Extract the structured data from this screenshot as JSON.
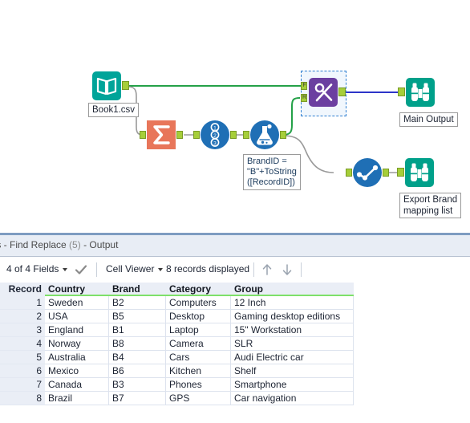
{
  "app": "Alteryx Designer",
  "canvas": {
    "nodes": [
      {
        "id": "input",
        "name": "Input Data",
        "icon": "book-icon",
        "label": "Book1.csv"
      },
      {
        "id": "summarize",
        "name": "Summarize",
        "icon": "sigma-icon",
        "label": ""
      },
      {
        "id": "recordid",
        "name": "Record ID",
        "icon": "numbers-icon",
        "label": ""
      },
      {
        "id": "formula",
        "name": "Formula",
        "icon": "flask-icon",
        "label": ""
      },
      {
        "id": "findreplace",
        "name": "Find Replace",
        "icon": "scissors-icon",
        "label": "",
        "selected": true
      },
      {
        "id": "select",
        "name": "Select",
        "icon": "checkline-icon",
        "label": ""
      },
      {
        "id": "browse1",
        "name": "Browse",
        "icon": "binoculars-icon",
        "label": "Main Output"
      },
      {
        "id": "browse2",
        "name": "Browse",
        "icon": "binoculars-icon",
        "label": "Export Brand\nmapping list"
      }
    ],
    "annotation": "BrandID =\n\"B\"+ToString\n([RecordID])",
    "anchor_labels": {
      "find": "F",
      "replace": "R"
    },
    "colors": {
      "input_teal": "#00a499",
      "summarize_salmon": "#e8765a",
      "tool_blue": "#1f6fb5",
      "findreplace_purple": "#6b3fa0",
      "browse_teal": "#00a08a",
      "anchor_green": "#a6ce39",
      "wire_green": "#24a148",
      "wire_blue": "#2d35c8",
      "wire_gray": "#9a9a9a",
      "selection_blue": "#2f7fd1"
    }
  },
  "results": {
    "tab_title_main": "ts - Find Replace",
    "tab_title_count": "(5)",
    "tab_title_suffix": "- Output",
    "toolbar": {
      "fields_label": "4 of 4 Fields",
      "check_icon": "checkmark-icon",
      "viewer_label": "Cell Viewer",
      "records_label": "8 records displayed",
      "up_icon": "arrow-up-icon",
      "down_icon": "arrow-down-icon"
    },
    "grid": {
      "columns": [
        "Record",
        "Country",
        "Brand",
        "Category",
        "Group"
      ],
      "rows": [
        [
          "1",
          "Sweden",
          "B2",
          "Computers",
          "12 Inch"
        ],
        [
          "2",
          "USA",
          "B5",
          "Desktop",
          "Gaming desktop editions"
        ],
        [
          "3",
          "England",
          "B1",
          "Laptop",
          "15\" Workstation"
        ],
        [
          "4",
          "Norway",
          "B8",
          "Camera",
          "SLR"
        ],
        [
          "5",
          "Australia",
          "B4",
          "Cars",
          "Audi Electric car"
        ],
        [
          "6",
          "Mexico",
          "B6",
          "Kitchen",
          "Shelf"
        ],
        [
          "7",
          "Canada",
          "B3",
          "Phones",
          "Smartphone"
        ],
        [
          "8",
          "Brazil",
          "B7",
          "GPS",
          "Car navigation"
        ]
      ]
    }
  }
}
